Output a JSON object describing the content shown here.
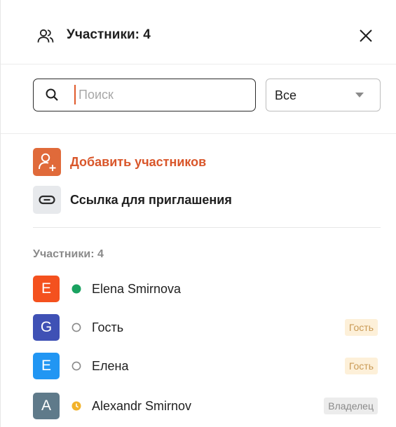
{
  "header": {
    "title": "Участники: 4",
    "icon": "users-icon"
  },
  "search": {
    "placeholder": "Поиск",
    "value": ""
  },
  "filter": {
    "selected": "Все"
  },
  "actions": {
    "add_members": "Добавить участников",
    "invite_link": "Ссылка для приглашения"
  },
  "members_section": {
    "title": "Участники: 4",
    "members": [
      {
        "initial": "E",
        "name": "Elena Smirnova",
        "status": "online",
        "role": "",
        "avatar_color": "#f4511e"
      },
      {
        "initial": "G",
        "name": "Гость",
        "status": "offline",
        "role": "Гость",
        "avatar_color": "#3f51b5"
      },
      {
        "initial": "E",
        "name": "Елена",
        "status": "offline",
        "role": "Гость",
        "avatar_color": "#2196f3"
      },
      {
        "initial": "A",
        "name": "Alexandr Smirnov",
        "status": "away",
        "role": "Владелец",
        "avatar_color": "#5f7a8a"
      }
    ]
  },
  "colors": {
    "accent": "#e06a3a",
    "online": "#1aa260",
    "away": "#f2b22a"
  }
}
